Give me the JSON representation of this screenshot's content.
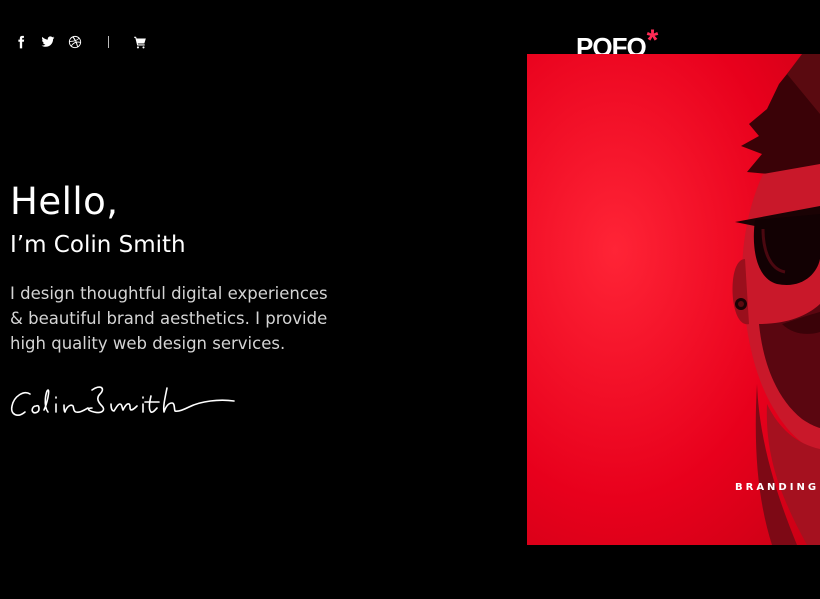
{
  "header": {
    "social_icons": [
      "facebook-icon",
      "twitter-icon",
      "dribbble-icon"
    ],
    "cart_icon": "cart-icon",
    "logo_text": "POFO",
    "logo_mark": "*"
  },
  "hero": {
    "greeting": "Hello,",
    "name_line": "I’m Colin Smith",
    "intro": "I design thoughtful digital experiences & beautiful brand aesthetics. I provide high quality web design services.",
    "signature": "Colin Smith"
  },
  "portfolio": {
    "category": "BRANDING"
  },
  "colors": {
    "background": "#000000",
    "accent": "#ff2b55",
    "photo_red": "#e8001c"
  }
}
